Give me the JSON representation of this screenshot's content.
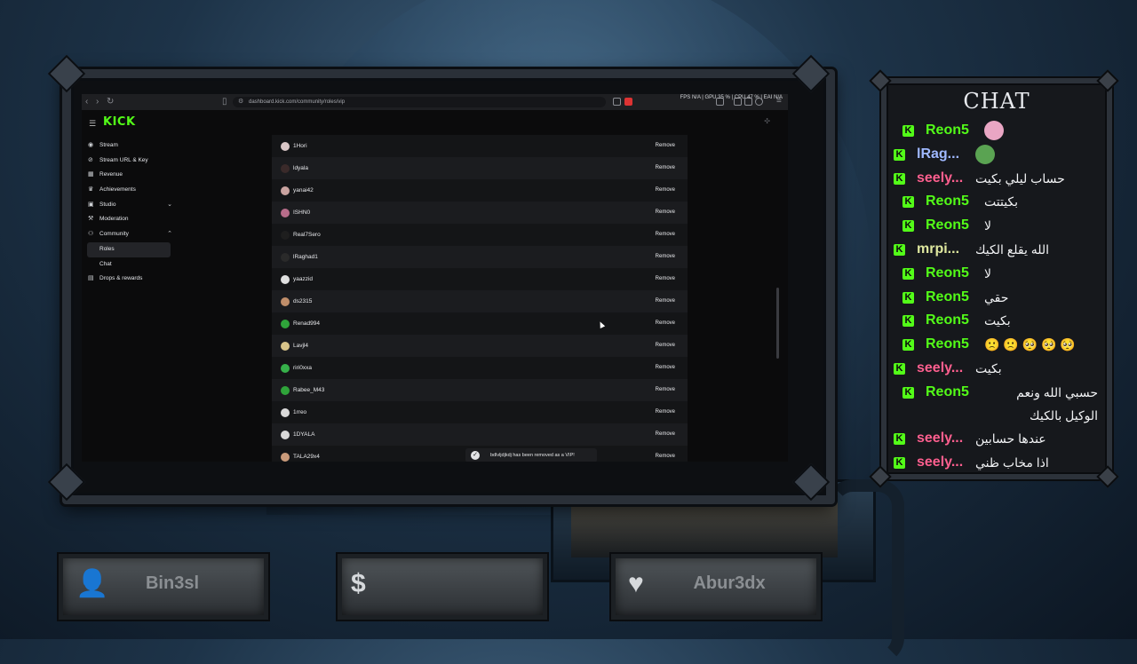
{
  "browser": {
    "url": "dashboard.kick.com/community/roles/vip",
    "stats": "FPS N/A | GPU 35 % | CPU 47 % | EAI N/A"
  },
  "sidebar": {
    "logo": "KICK",
    "items": [
      {
        "icon": "stream-icon",
        "label": "Stream"
      },
      {
        "icon": "link-icon",
        "label": "Stream URL & Key"
      },
      {
        "icon": "revenue-icon",
        "label": "Revenue"
      },
      {
        "icon": "trophy-icon",
        "label": "Achievements"
      },
      {
        "icon": "studio-icon",
        "label": "Studio"
      },
      {
        "icon": "wrench-icon",
        "label": "Moderation"
      },
      {
        "icon": "community-icon",
        "label": "Community"
      },
      {
        "icon": "",
        "label": "Roles"
      },
      {
        "icon": "",
        "label": "Chat"
      },
      {
        "icon": "gift-icon",
        "label": "Drops & rewards"
      }
    ]
  },
  "vip_list": {
    "remove_label": "Remove",
    "users": [
      "1Hori",
      "ldyala",
      "yanai42",
      "ISHN0",
      "Real7Sero",
      "lRaghad1",
      "yaazzid",
      "ds2315",
      "Renad994",
      "Lavjl4",
      "riri0xxa",
      "Rabee_M43",
      "1rreo",
      "1DYALA",
      "TALA29x4"
    ],
    "avatar_colors": [
      "#d9c7c7",
      "#3a2a2a",
      "#c9a3a0",
      "#b76d8a",
      "#1e1e1e",
      "#2a2a2a",
      "#e0e0e0",
      "#c08e6a",
      "#2fa43a",
      "#d8c48a",
      "#36b04a",
      "#2fa43a",
      "#d9d9d9",
      "#d9d9d9",
      "#c99a7a"
    ]
  },
  "toast": {
    "text": "bdlvljdjkdj has been removed as a VIP!"
  },
  "chat": {
    "title": "CHAT",
    "messages": [
      {
        "user": "Reon5",
        "color": "#53fc18",
        "text": "",
        "emote": "#e9a6c4"
      },
      {
        "user": "lRag...",
        "color": "#9fb8ff",
        "text": "",
        "emote": "#5aa352"
      },
      {
        "user": "seely...",
        "color": "#ff5f8f",
        "text": "حساب ليلي بكيت",
        "emote": ""
      },
      {
        "user": "Reon5",
        "color": "#53fc18",
        "text": "بكيتتت",
        "emote": ""
      },
      {
        "user": "Reon5",
        "color": "#53fc18",
        "text": "لا",
        "emote": ""
      },
      {
        "user": "mrpi...",
        "color": "#dfe89f",
        "text": "الله يقلع الكيك",
        "emote": ""
      },
      {
        "user": "Reon5",
        "color": "#53fc18",
        "text": "لا",
        "emote": ""
      },
      {
        "user": "Reon5",
        "color": "#53fc18",
        "text": "حقي",
        "emote": ""
      },
      {
        "user": "Reon5",
        "color": "#53fc18",
        "text": "بكيت",
        "emote": ""
      },
      {
        "user": "Reon5",
        "color": "#53fc18",
        "text": "🙁 🙁 🥺 🥺 🥺",
        "emote": ""
      },
      {
        "user": "seely...",
        "color": "#ff5f8f",
        "text": "بكيت",
        "emote": ""
      },
      {
        "user": "Reon5",
        "color": "#53fc18",
        "text": "حسبي الله ونعم الوكيل بالكيك",
        "emote": ""
      },
      {
        "user": "seely...",
        "color": "#ff5f8f",
        "text": "عندها حسابين",
        "emote": ""
      },
      {
        "user": "seely...",
        "color": "#ff5f8f",
        "text": "اذا مخاب ظني",
        "emote": ""
      }
    ]
  },
  "bottom": {
    "follower": "Bin3sl",
    "donation": "",
    "subscriber": "Abur3dx"
  }
}
